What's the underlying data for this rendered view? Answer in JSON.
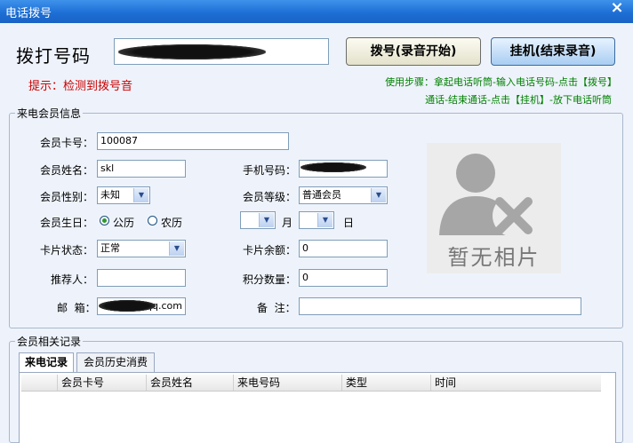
{
  "window": {
    "title": "电话拨号",
    "close_glyph": "×"
  },
  "dial": {
    "label": "拨打号码",
    "phone_value": "",
    "dial_button": "拨号(录音开始)",
    "hangup_button": "挂机(结束录音)",
    "tip": "提示：检测到拨号音",
    "usage_line1": "使用步骤：拿起电话听筒-输入电话号码-点击【拨号】",
    "usage_line2": "通话-结束通话-点击【挂机】-放下电话听筒"
  },
  "member_info": {
    "legend": "来电会员信息",
    "card_no_label": "会员卡号：",
    "card_no_value": "100087",
    "name_label": "会员姓名：",
    "name_value": "skl",
    "mobile_label": "手机号码：",
    "mobile_value": "",
    "gender_label": "会员性别：",
    "gender_value": "未知",
    "level_label": "会员等级：",
    "level_value": "普通会员",
    "birthday_label": "会员生日：",
    "calendar_solar": "公历",
    "calendar_lunar": "农历",
    "calendar_selected": "公历",
    "month_unit": "月",
    "day_unit": "日",
    "card_status_label": "卡片状态：",
    "card_status_value": "正常",
    "balance_label": "卡片余额：",
    "balance_value": "0",
    "referrer_label": "推荐人：",
    "referrer_value": "",
    "points_label": "积分数量：",
    "points_value": "0",
    "email_label": "邮  箱：",
    "email_value": "qq.com",
    "remark_label": "备  注：",
    "remark_value": "",
    "photo_caption": "暂无相片"
  },
  "records": {
    "legend": "会员相关记录",
    "tabs": [
      {
        "label": "来电记录",
        "active": true
      },
      {
        "label": "会员历史消费",
        "active": false
      }
    ],
    "columns": [
      "会员卡号",
      "会员姓名",
      "来电号码",
      "类型",
      "时间"
    ],
    "rows": []
  },
  "icons": {
    "close": "close-icon",
    "dropdown": "chevron-down-icon",
    "no_photo": "user-silhouette-with-x-icon"
  },
  "colors": {
    "titlebar": "#1d6fd6",
    "tip_text": "#cc0000",
    "usage_text": "#008000",
    "client_bg": "#eef3fb"
  }
}
